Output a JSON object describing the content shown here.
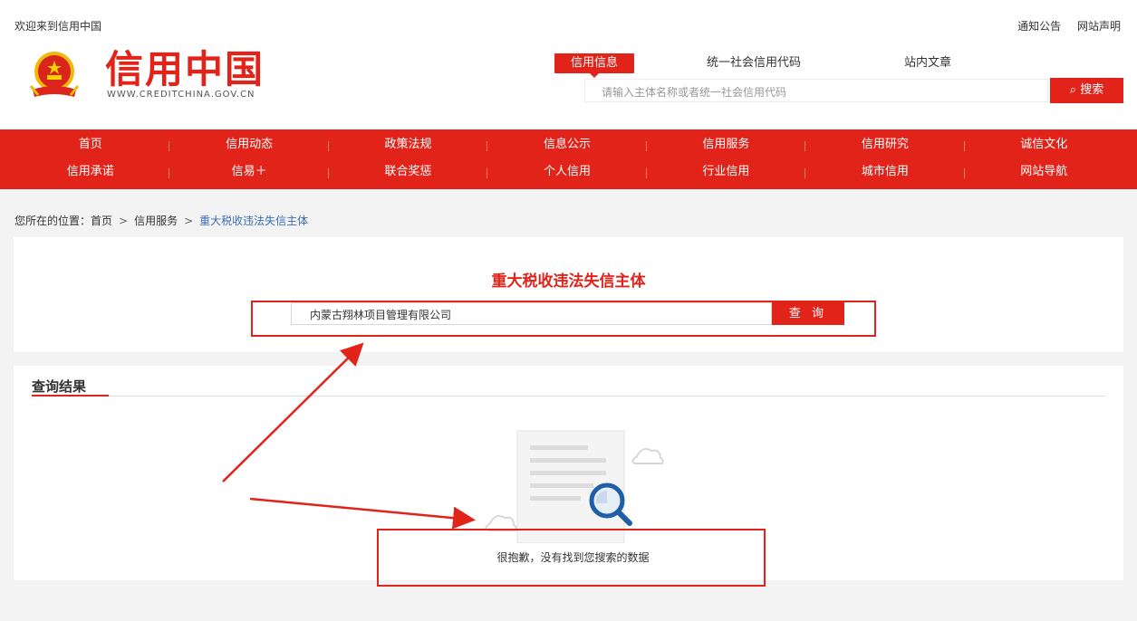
{
  "topbar": {
    "welcome": "欢迎来到信用中国",
    "notice": "通知公告",
    "statement": "网站声明"
  },
  "brand": {
    "title": "信用中国",
    "url": "WWW.CREDITCHINA.GOV.CN"
  },
  "search_tabs": [
    "信用信息",
    "统一社会信用代码",
    "站内文章"
  ],
  "header_search": {
    "placeholder": "请输入主体名称或者统一社会信用代码",
    "button": "搜索"
  },
  "nav": {
    "row1": [
      "首页",
      "信用动态",
      "政策法规",
      "信息公示",
      "信用服务",
      "信用研究",
      "诚信文化"
    ],
    "row2": [
      "信用承诺",
      "信易＋",
      "联合奖惩",
      "个人信用",
      "行业信用",
      "城市信用",
      "网站导航"
    ]
  },
  "breadcrumb": {
    "prefix": "您所在的位置：",
    "home": "首页",
    "sep": ">",
    "section": "信用服务",
    "current": "重大税收违法失信主体"
  },
  "query": {
    "title": "重大税收违法失信主体",
    "input_value": "内蒙古翔林项目管理有限公司",
    "button": "查 询"
  },
  "results": {
    "title": "查询结果",
    "empty_message": "很抱歉，没有找到您搜索的数据"
  },
  "colors": {
    "brand_red": "#e2231a",
    "link_blue": "#3a6db8",
    "magnifier_blue": "#1f5fa8"
  }
}
